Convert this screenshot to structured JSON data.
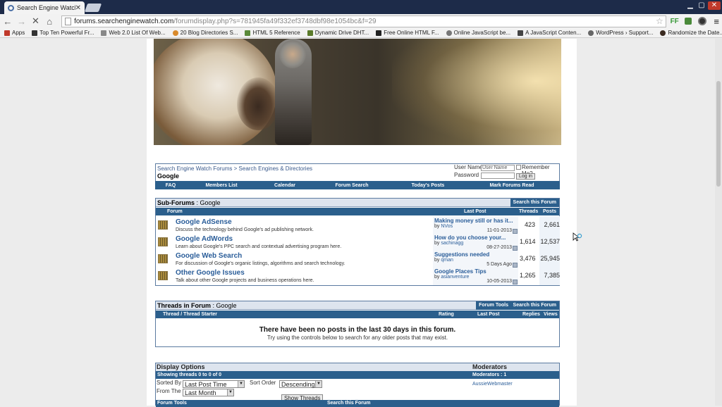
{
  "browser": {
    "tab_title": "Search Engine Watch Foru",
    "tab_close": "✕",
    "url_domain": "forums.searchenginewatch.com",
    "url_rest": "/forumdisplay.php?s=781945fa49f332ef3748dbf98e1054bc&f=29",
    "ext_icon_text": "FF",
    "bookmarks": [
      "Apps",
      "Top Ten Powerful Fr...",
      "Web 2.0 List Of Web...",
      "20 Blog Directories S...",
      "HTML 5 Reference",
      "Dynamic Drive DHT...",
      "Free Online HTML F...",
      "Online JavaScript be...",
      "A JavaScript Conten...",
      "WordPress › Support...",
      "Randomize the Date..."
    ]
  },
  "nav": {
    "breadcrumb": "Search Engine Watch Forums > Search Engines & Directories",
    "forum_name": "Google",
    "username_label": "User Name",
    "username_placeholder": "User Name",
    "password_label": "Password",
    "remember_label": "Remember Me?",
    "login_button": "Log in",
    "links": [
      "FAQ",
      "Members List",
      "Calendar",
      "Forum Search",
      "Today's Posts",
      "Mark Forums Read"
    ]
  },
  "subforums": {
    "title": "Sub-Forums",
    "title_suffix": ": Google",
    "search_button": "Search this Forum",
    "col_forum": "Forum",
    "col_last_post": "Last Post",
    "col_threads": "Threads",
    "col_posts": "Posts",
    "rows": [
      {
        "name": "Google AdSense",
        "desc": "Discuss the technology behind Google's ad publishing network.",
        "lp_title": "Making money still or has it...",
        "lp_by": "by",
        "lp_user": "NVos",
        "lp_date": "11-01-2013",
        "threads": "423",
        "posts": "2,661"
      },
      {
        "name": "Google AdWords",
        "desc": "Learn about Google's PPC search and contextual advertising program here.",
        "lp_title": "How do you choose your...",
        "lp_by": "by",
        "lp_user": "sachinagg",
        "lp_date": "08-27-2013",
        "threads": "1,614",
        "posts": "12,537"
      },
      {
        "name": "Google Web Search",
        "desc": "For discussion of Google's organic listings, algorithms and search technology.",
        "lp_title": "Suggestions needed",
        "lp_by": "by",
        "lp_user": "qman",
        "lp_date": "5 Days Ago",
        "threads": "3,476",
        "posts": "25,945"
      },
      {
        "name": "Other Google Issues",
        "desc": "Talk about other Google projects and business operations here.",
        "lp_title": "Google Places Tips",
        "lp_by": "by",
        "lp_user": "asianventure",
        "lp_date": "10-05-2013",
        "threads": "1,265",
        "posts": "7,385"
      }
    ]
  },
  "threads": {
    "title": "Threads in Forum",
    "title_suffix": ": Google",
    "tools_button": "Forum Tools",
    "search_button": "Search this Forum",
    "col_thread": "Thread / Thread Starter",
    "col_rating": "Rating",
    "col_last_post": "Last Post",
    "col_replies": "Replies",
    "col_views": "Views",
    "empty_title": "There have been no posts in the last 30 days in this forum.",
    "empty_hint": "Try using the controls below to search for any older posts that may exist."
  },
  "display": {
    "title": "Display Options",
    "moderators_title": "Moderators",
    "showing": "Showing threads 0 to 0 of 0",
    "moderators_count": "Moderators : 1",
    "moderator_name": "AussieWebmaster",
    "sorted_by_label": "Sorted By",
    "sorted_by_value": "Last Post Time",
    "sort_order_label": "Sort Order",
    "sort_order_value": "Descending",
    "from_the_label": "From The",
    "from_the_value": "Last Month",
    "show_button": "Show Threads",
    "footer_tools": "Forum Tools",
    "footer_search": "Search this Forum"
  }
}
